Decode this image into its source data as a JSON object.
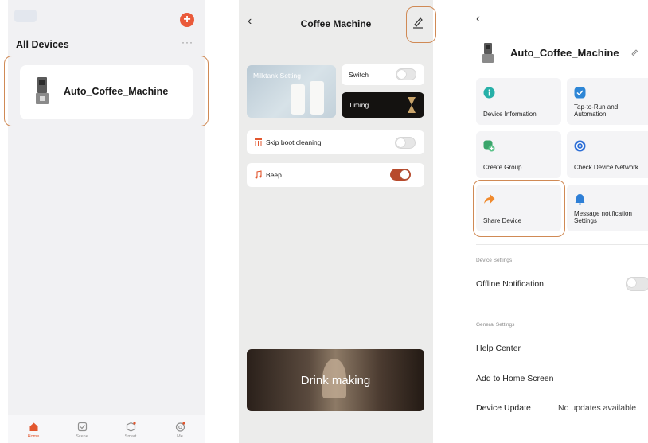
{
  "home": {
    "add_icon": "plus-icon",
    "section_title": "All Devices",
    "more_label": "···",
    "device_name": "Auto_Coffee_Machine",
    "tabs": [
      {
        "label": "Home",
        "icon": "home-icon",
        "active": true
      },
      {
        "label": "Scene",
        "icon": "checkbox-icon",
        "active": false
      },
      {
        "label": "Smart",
        "icon": "cube-icon",
        "active": false
      },
      {
        "label": "Me",
        "icon": "face-icon",
        "active": false
      }
    ]
  },
  "panel": {
    "title": "Coffee Machine",
    "back_label": "‹",
    "milk_label": "Milktank Setting",
    "switch_label": "Switch",
    "switch_on": false,
    "timing_label": "Timing",
    "skip_label": "Skip boot cleaning",
    "skip_on": false,
    "beep_label": "Beep",
    "beep_on": true,
    "drink_label": "Drink making"
  },
  "settings": {
    "back_label": "‹",
    "device_name": "Auto_Coffee_Machine",
    "tiles": [
      {
        "label": "Device Information",
        "icon": "info-icon",
        "color": "#27b0a8"
      },
      {
        "label": "Tap-to-Run and Automation",
        "icon": "check-shield-icon",
        "color": "#2e86d6"
      },
      {
        "label": "Create Group",
        "icon": "group-icon",
        "color": "#3aa56b"
      },
      {
        "label": "Check Device Network",
        "icon": "network-icon",
        "color": "#2e6fd6"
      },
      {
        "label": "Share Device",
        "icon": "share-arrow-icon",
        "color": "#f08a2e"
      },
      {
        "label": "Message notification Settings",
        "icon": "bell-icon",
        "color": "#2e7fd6"
      }
    ],
    "device_settings_label": "Device Settings",
    "offline_label": "Offline Notification",
    "offline_on": false,
    "general_label": "General Settings",
    "help_label": "Help Center",
    "add_home_label": "Add to Home Screen",
    "update_label": "Device Update",
    "update_value": "No updates available"
  },
  "colors": {
    "accent": "#e2572f",
    "highlight": "#d08a55"
  }
}
